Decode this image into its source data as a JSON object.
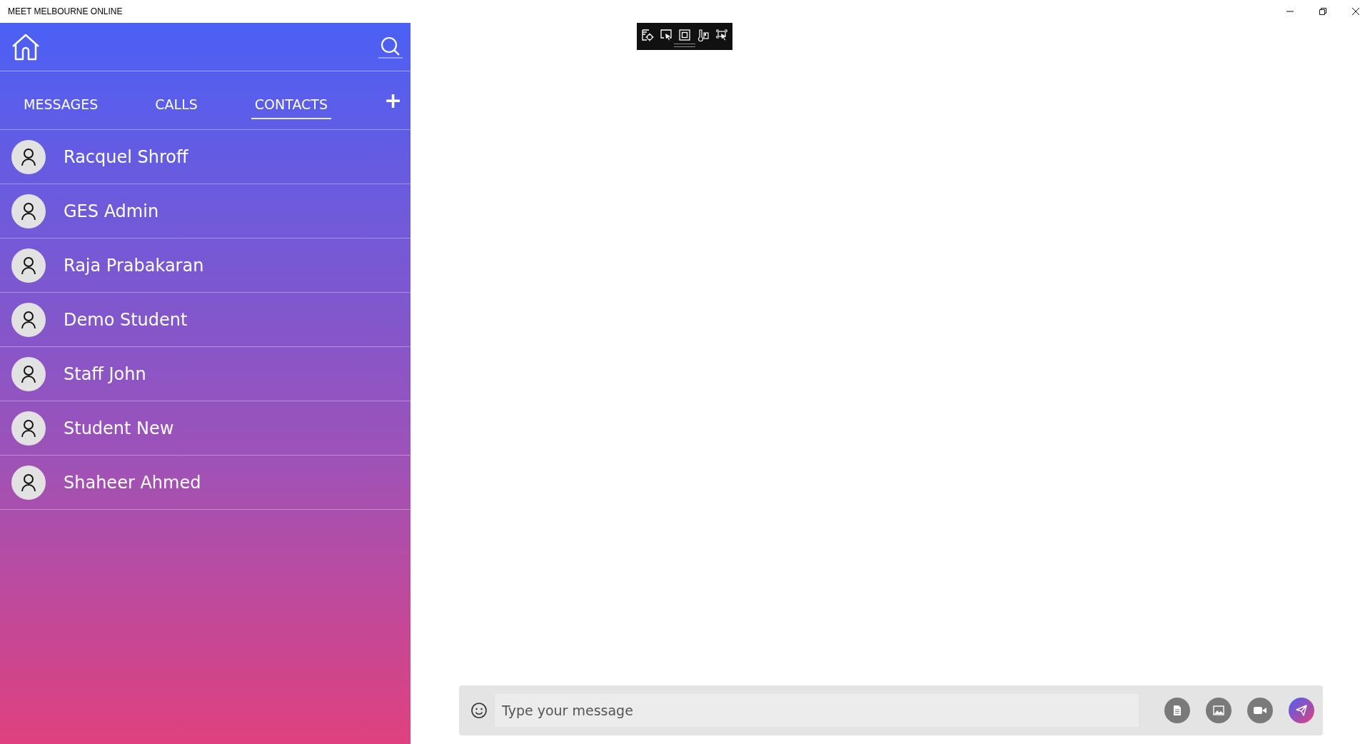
{
  "window": {
    "title": "MEET MELBOURNE ONLINE"
  },
  "tabs": [
    {
      "label": "MESSAGES",
      "selected": false
    },
    {
      "label": "CALLS",
      "selected": false
    },
    {
      "label": "CONTACTS",
      "selected": true
    }
  ],
  "add_button": {
    "label": "+"
  },
  "contacts": [
    {
      "name": "Racquel Shroff"
    },
    {
      "name": "GES Admin"
    },
    {
      "name": "Raja Prabakaran"
    },
    {
      "name": "Demo Student"
    },
    {
      "name": "Staff John"
    },
    {
      "name": "Student New"
    },
    {
      "name": "Shaheer Ahmed"
    }
  ],
  "composer": {
    "placeholder": "Type your message"
  }
}
